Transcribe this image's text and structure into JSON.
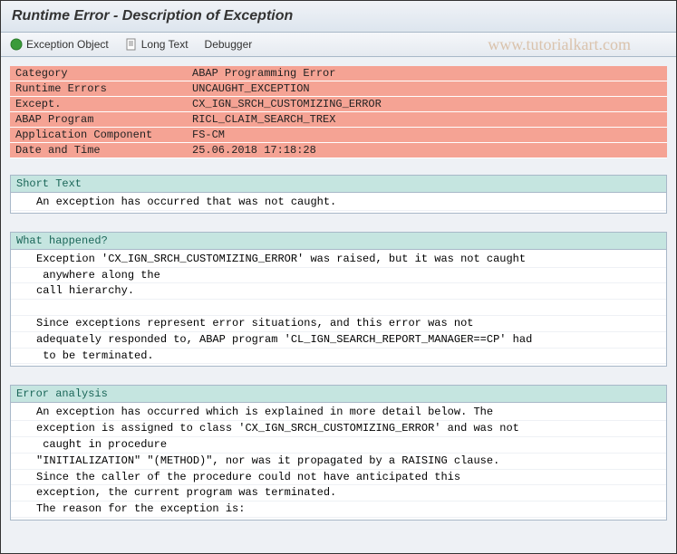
{
  "title": "Runtime Error - Description of Exception",
  "watermark": "www.tutorialkart.com",
  "toolbar": {
    "exception_object": "Exception Object",
    "long_text": "Long Text",
    "debugger": "Debugger"
  },
  "info_rows": [
    {
      "label": "Category",
      "value": "ABAP Programming Error"
    },
    {
      "label": "Runtime Errors",
      "value": "UNCAUGHT_EXCEPTION"
    },
    {
      "label": "Except.",
      "value": "CX_IGN_SRCH_CUSTOMIZING_ERROR"
    },
    {
      "label": "ABAP Program",
      "value": "RICL_CLAIM_SEARCH_TREX"
    },
    {
      "label": "Application Component",
      "value": "FS-CM"
    },
    {
      "label": "Date and Time",
      "value": "25.06.2018 17:18:28"
    }
  ],
  "sections": {
    "short_text": {
      "title": "Short Text",
      "lines": [
        "An exception has occurred that was not caught."
      ]
    },
    "what_happened": {
      "title": "What happened?",
      "lines": [
        "Exception 'CX_IGN_SRCH_CUSTOMIZING_ERROR' was raised, but it was not caught",
        " anywhere along the",
        "call hierarchy.",
        "",
        "Since exceptions represent error situations, and this error was not",
        "adequately responded to, ABAP program 'CL_IGN_SEARCH_REPORT_MANAGER==CP' had",
        " to be terminated."
      ]
    },
    "error_analysis": {
      "title": "Error analysis",
      "lines": [
        "An exception has occurred which is explained in more detail below. The",
        "exception is assigned to class 'CX_IGN_SRCH_CUSTOMIZING_ERROR' and was not",
        " caught in procedure",
        "\"INITIALIZATION\" \"(METHOD)\", nor was it propagated by a RAISING clause.",
        "Since the caller of the procedure could not have anticipated this",
        "exception, the current program was terminated.",
        "The reason for the exception is:"
      ]
    }
  }
}
